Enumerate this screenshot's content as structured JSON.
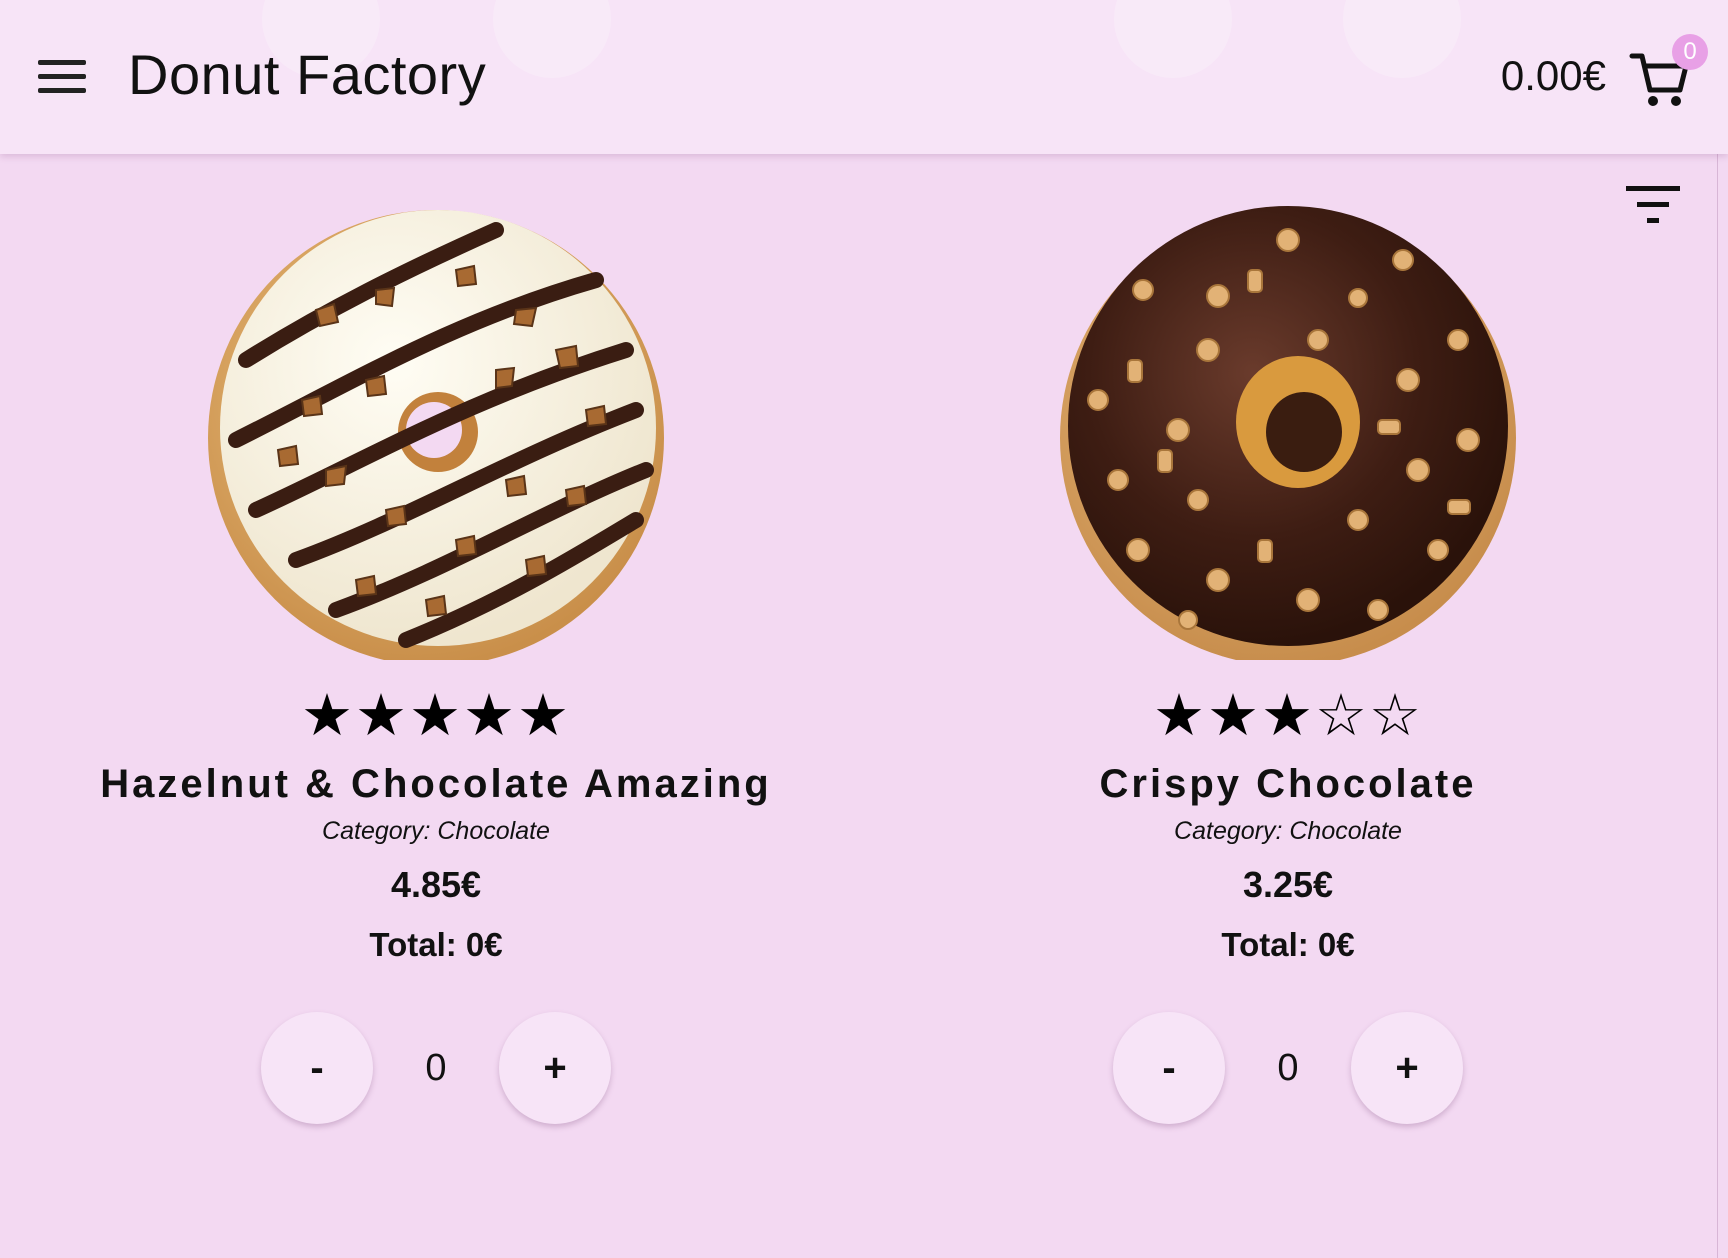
{
  "header": {
    "title": "Donut Factory",
    "cart_total": "0.00€",
    "cart_count": "0"
  },
  "products": [
    {
      "name": "Hazelnut & Chocolate Amazing",
      "category": "Category: Chocolate",
      "price": "4.85€",
      "total": "Total: 0€",
      "quantity": "0",
      "rating": 5,
      "stars": "★★★★★",
      "decrement_label": "-",
      "increment_label": "+"
    },
    {
      "name": "Crispy Chocolate",
      "category": "Category: Chocolate",
      "price": "3.25€",
      "total": "Total: 0€",
      "quantity": "0",
      "rating": 3,
      "stars": "★★★☆☆",
      "decrement_label": "-",
      "increment_label": "+"
    }
  ],
  "colors": {
    "background": "#f3d9f2",
    "header": "#f7e4f7",
    "badge": "#e8a0e6",
    "button": "#f7e4f7"
  },
  "icons": {
    "menu": "hamburger-menu-icon",
    "cart": "shopping-cart-icon",
    "filter": "filter-icon"
  }
}
